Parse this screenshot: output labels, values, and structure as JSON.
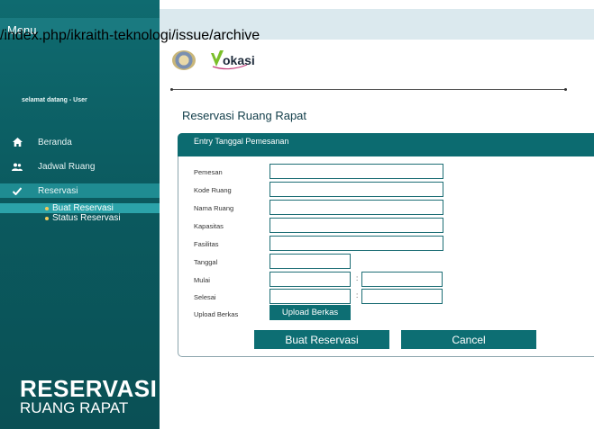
{
  "url_overlay": "/index.php/ikraith-teknologi/issue/archive",
  "sidebar": {
    "menu_title": "Menu",
    "welcome": "selamat datang - User",
    "items": [
      {
        "label": "Beranda",
        "icon": "home-icon"
      },
      {
        "label": "Jadwal Ruang",
        "icon": "users-icon"
      },
      {
        "label": "Reservasi",
        "icon": "check-icon"
      }
    ],
    "subitems": [
      {
        "label": "Buat Reservasi"
      },
      {
        "label": "Status Reservasi"
      }
    ],
    "brand_title": "RESERVASI",
    "brand_subtitle": "RUANG RAPAT"
  },
  "logo": {
    "text": "okasi"
  },
  "page_title": "Reservasi Ruang Rapat",
  "form": {
    "header": "Entry Tanggal Pemesanan",
    "labels": {
      "pemesan": "Pemesan",
      "kode_ruang": "Kode Ruang",
      "nama_ruang": "Nama Ruang",
      "kapasitas": "Kapasitas",
      "fasilitas": "Fasilitas",
      "tanggal": "Tanggal",
      "mulai": "Mulai",
      "selesai": "Selesai",
      "upload": "Upload Berkas"
    },
    "values": {
      "pemesan": "",
      "kode_ruang": "",
      "nama_ruang": "",
      "kapasitas": "",
      "fasilitas": "",
      "tanggal": "",
      "mulai_jam": "",
      "mulai_menit": "",
      "selesai_jam": "",
      "selesai_menit": ""
    },
    "colon": ":",
    "upload_button": "Upload Berkas",
    "submit_button": "Buat Reservasi",
    "cancel_button": "Cancel"
  },
  "colors": {
    "sidebar": "#0b5a5f",
    "accent": "#0d6e73",
    "highlight": "#2ba3a9",
    "bullet": "#f2c95a"
  }
}
